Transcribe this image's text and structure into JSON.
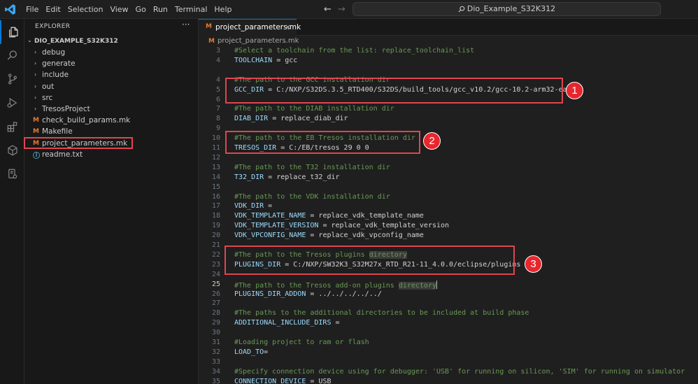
{
  "titlebar": {
    "menu": [
      "File",
      "Edit",
      "Selection",
      "View",
      "Go",
      "Run",
      "Terminal",
      "Help"
    ],
    "back": "←",
    "forward": "→",
    "search_text": "Dio_Example_S32K312"
  },
  "sidebar": {
    "title": "EXPLORER",
    "more": "···",
    "folder_chevron": "⌄",
    "folder_name": "DIO_EXAMPLE_S32K312",
    "items": [
      {
        "label": "debug",
        "type": "folder",
        "chevron": "›"
      },
      {
        "label": "generate",
        "type": "folder",
        "chevron": "›"
      },
      {
        "label": "include",
        "type": "folder",
        "chevron": "›"
      },
      {
        "label": "out",
        "type": "folder",
        "chevron": "›"
      },
      {
        "label": "src",
        "type": "folder",
        "chevron": "›"
      },
      {
        "label": "TresosProject",
        "type": "folder",
        "chevron": "›"
      },
      {
        "label": "check_build_params.mk",
        "type": "makefile",
        "icon": "M"
      },
      {
        "label": "Makefile",
        "type": "makefile",
        "icon": "M"
      },
      {
        "label": "project_parameters.mk",
        "type": "makefile",
        "icon": "M",
        "selected": true
      },
      {
        "label": "readme.txt",
        "type": "info",
        "icon": "i"
      }
    ]
  },
  "editor": {
    "tab": {
      "icon": "M",
      "label": "project_parameters.mk",
      "close": "×"
    },
    "breadcrumb": {
      "icon": "M",
      "label": "project_parameters.mk"
    },
    "current_line": 25,
    "lines": [
      {
        "n": "3",
        "parts": [
          {
            "t": "#Select a toolchain from the list: replace_toolchain_list",
            "c": "comment"
          }
        ]
      },
      {
        "n": "4",
        "parts": [
          {
            "t": "TOOLCHAIN",
            "c": "var"
          },
          {
            "t": " = gcc",
            "c": "plain"
          }
        ]
      },
      {
        "n": "",
        "parts": []
      },
      {
        "n": "4",
        "parts": [
          {
            "t": "#The path to the GCC installation dir",
            "c": "comment"
          }
        ]
      },
      {
        "n": "5",
        "parts": [
          {
            "t": "GCC_DIR",
            "c": "var"
          },
          {
            "t": " = C:/NXP/S32DS.3.5_RTD400/S32DS/build_tools/gcc_v10.2/gcc-10.2-arm32-eabi",
            "c": "plain"
          }
        ]
      },
      {
        "n": "6",
        "parts": []
      },
      {
        "n": "7",
        "parts": [
          {
            "t": "#The path to the DIAB installation dir",
            "c": "comment"
          }
        ]
      },
      {
        "n": "8",
        "parts": [
          {
            "t": "DIAB_DIR",
            "c": "var"
          },
          {
            "t": " = replace_diab_dir",
            "c": "plain"
          }
        ]
      },
      {
        "n": "9",
        "parts": []
      },
      {
        "n": "10",
        "parts": [
          {
            "t": "#The path to the EB Tresos installation dir",
            "c": "comment"
          }
        ]
      },
      {
        "n": "11",
        "parts": [
          {
            "t": "TRESOS_DIR",
            "c": "var"
          },
          {
            "t": " = C:/EB/tresos 29 0 0",
            "c": "plain"
          }
        ]
      },
      {
        "n": "12",
        "parts": []
      },
      {
        "n": "13",
        "parts": [
          {
            "t": "#The path to the T32 installation dir",
            "c": "comment"
          }
        ]
      },
      {
        "n": "14",
        "parts": [
          {
            "t": "T32_DIR",
            "c": "var"
          },
          {
            "t": " = replace_t32_dir",
            "c": "plain"
          }
        ]
      },
      {
        "n": "15",
        "parts": []
      },
      {
        "n": "16",
        "parts": [
          {
            "t": "#The path to the VDK installation dir",
            "c": "comment"
          }
        ]
      },
      {
        "n": "17",
        "parts": [
          {
            "t": "VDK_DIR",
            "c": "var"
          },
          {
            "t": " =",
            "c": "plain"
          }
        ]
      },
      {
        "n": "18",
        "parts": [
          {
            "t": "VDK_TEMPLATE_NAME",
            "c": "var"
          },
          {
            "t": " = replace_vdk_template_name",
            "c": "plain"
          }
        ]
      },
      {
        "n": "19",
        "parts": [
          {
            "t": "VDK_TEMPLATE_VERSION",
            "c": "var"
          },
          {
            "t": " = replace_vdk_template_version",
            "c": "plain"
          }
        ]
      },
      {
        "n": "20",
        "parts": [
          {
            "t": "VDK_VPCONFIG_NAME",
            "c": "var"
          },
          {
            "t": " = replace_vdk_vpconfig_name",
            "c": "plain"
          }
        ]
      },
      {
        "n": "21",
        "parts": []
      },
      {
        "n": "22",
        "parts": [
          {
            "t": "#The path to the Tresos plugins ",
            "c": "comment"
          },
          {
            "t": "directory",
            "c": "comment hl"
          }
        ]
      },
      {
        "n": "23",
        "parts": [
          {
            "t": "PLUGINS_DIR",
            "c": "var"
          },
          {
            "t": " = C:/NXP/SW32K3_S32M27x_RTD_R21-11_4.0.0/eclipse/plugins",
            "c": "plain"
          }
        ]
      },
      {
        "n": "24",
        "parts": []
      },
      {
        "n": "25",
        "parts": [
          {
            "t": "#The path to the Tresos add-on plugins ",
            "c": "comment"
          },
          {
            "t": "directory",
            "c": "comment hl"
          }
        ],
        "cursor": true
      },
      {
        "n": "26",
        "parts": [
          {
            "t": "PLUGINS_DIR_ADDON",
            "c": "var"
          },
          {
            "t": " = ../../../../../",
            "c": "plain"
          }
        ]
      },
      {
        "n": "27",
        "parts": []
      },
      {
        "n": "28",
        "parts": [
          {
            "t": "#The paths to the additional directories to be included at build phase",
            "c": "comment"
          }
        ]
      },
      {
        "n": "29",
        "parts": [
          {
            "t": "ADDITIONAL_INCLUDE_DIRS",
            "c": "var"
          },
          {
            "t": " =",
            "c": "plain"
          }
        ]
      },
      {
        "n": "30",
        "parts": []
      },
      {
        "n": "31",
        "parts": [
          {
            "t": "#Loading project to ram or flash",
            "c": "comment"
          }
        ]
      },
      {
        "n": "32",
        "parts": [
          {
            "t": "LOAD_TO",
            "c": "var"
          },
          {
            "t": "=",
            "c": "plain"
          }
        ]
      },
      {
        "n": "33",
        "parts": []
      },
      {
        "n": "34",
        "parts": [
          {
            "t": "#Specify connection device using for debugger: 'USB' for running on silicon, 'SIM' for running on simulator",
            "c": "comment"
          }
        ]
      },
      {
        "n": "35",
        "parts": [
          {
            "t": "CONNECTION_DEVICE",
            "c": "var"
          },
          {
            "t": " = USB",
            "c": "plain"
          }
        ]
      }
    ]
  },
  "annotations": [
    "1",
    "2",
    "3"
  ],
  "colors": {
    "accent": "#0078d4",
    "annotation": "#e04550",
    "comment": "#6a9955",
    "variable": "#9cdcfe"
  }
}
